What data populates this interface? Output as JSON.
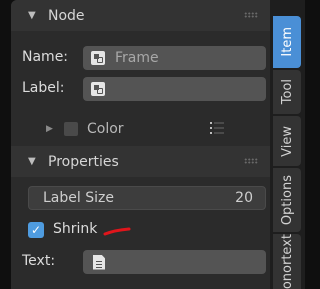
{
  "node_panel": {
    "title": "Node",
    "name_label": "Name:",
    "name_value": "Frame",
    "label_label": "Label:",
    "label_value": "",
    "color_label": "Color"
  },
  "properties_panel": {
    "title": "Properties",
    "label_size": {
      "label": "Label Size",
      "value": "20"
    },
    "shrink": {
      "label": "Shrink",
      "checked": true
    },
    "text_label": "Text:"
  },
  "tabs": [
    {
      "label": "Item",
      "active": true
    },
    {
      "label": "Tool",
      "active": false
    },
    {
      "label": "View",
      "active": false
    },
    {
      "label": "Options",
      "active": false
    },
    {
      "label": "onortext",
      "active": false
    }
  ],
  "colors": {
    "accent": "#4a8fd6",
    "panel": "#2b2b2b",
    "header": "#333333",
    "field": "#545454",
    "red_mark": "#e0151b"
  },
  "icons": {
    "node_icon": "node-icon",
    "text_icon": "text-document-icon",
    "list_icon": "list-icon"
  }
}
